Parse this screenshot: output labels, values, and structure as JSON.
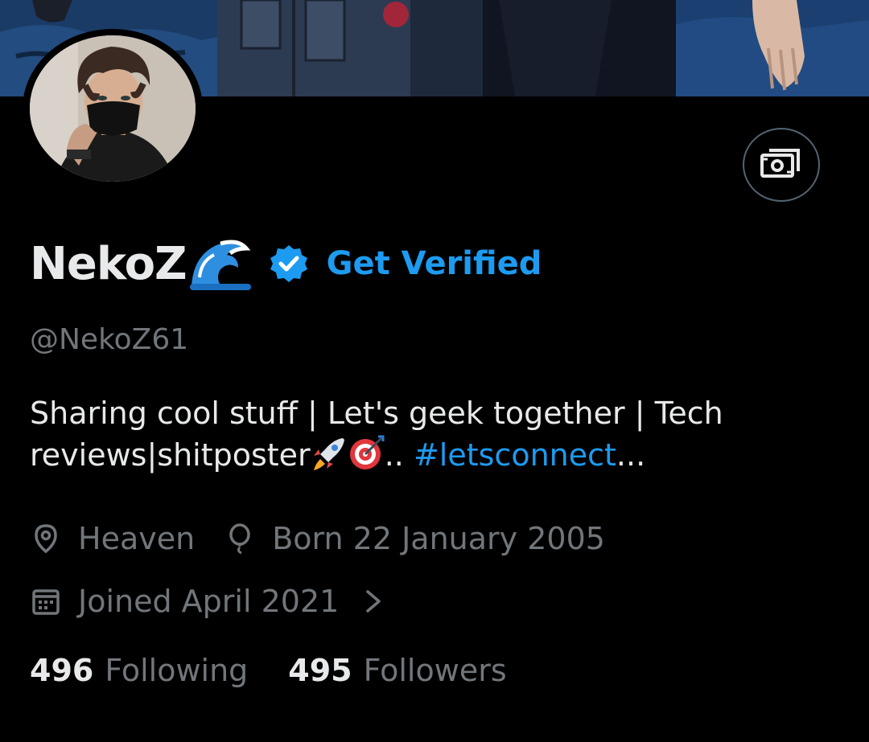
{
  "profile": {
    "display_name": "NekoZ",
    "name_emoji": "wave-emoji",
    "verify_cta": "Get Verified",
    "handle": "@NekoZ61",
    "bio": {
      "text": "Sharing cool stuff | Let's geek together | Tech reviews|shitposter",
      "emojis": [
        "rocket-emoji",
        "bullseye-emoji"
      ],
      "separator": "..",
      "hashtag": "#letsconnect",
      "truncation": "..."
    },
    "location": "Heaven",
    "birthday": "Born 22 January 2005",
    "joined": "Joined April 2021"
  },
  "stats": {
    "following_count": "496",
    "following_label": "Following",
    "followers_count": "495",
    "followers_label": "Followers"
  },
  "icons": {
    "tip": "tip-jar-icon",
    "verified": "verified-badge-icon",
    "location": "location-pin-icon",
    "birthday": "balloon-icon",
    "joined": "calendar-icon",
    "joined_chevron": "chevron-right-icon"
  },
  "colors": {
    "background": "#000000",
    "primary_text": "#e7e9ea",
    "secondary_text": "#71767b",
    "accent": "#1d9bf0",
    "border": "#536471"
  }
}
